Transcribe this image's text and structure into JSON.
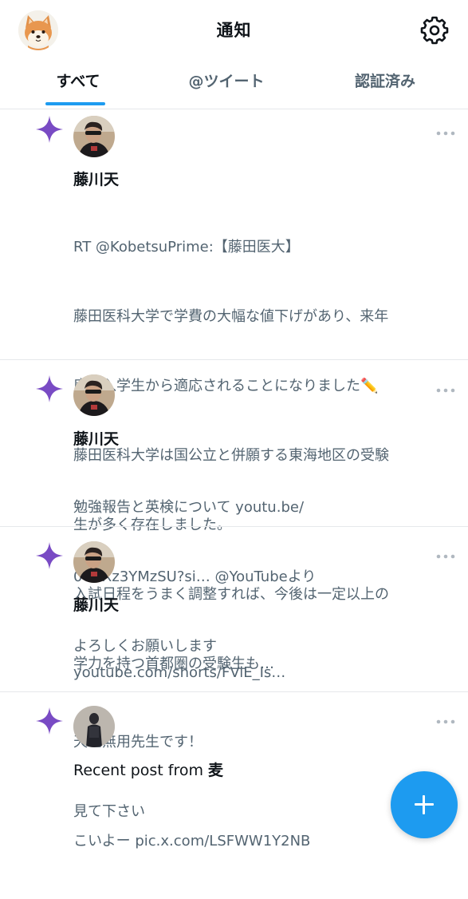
{
  "header": {
    "title": "通知",
    "avatar_icon": "shiba-dog-avatar",
    "settings_icon": "gear-icon"
  },
  "tabs": [
    {
      "label": "すべて",
      "active": true
    },
    {
      "label": "@ツイート",
      "active": false
    },
    {
      "label": "認証済み",
      "active": false
    }
  ],
  "colors": {
    "accent": "#1d9bf0",
    "sparkle": "#794bc4",
    "secondary_text": "#536471"
  },
  "notifications": [
    {
      "name": "藤川天",
      "lines": [
        "RT @KobetsuPrime:【藤田医大】",
        "藤田医科大学で学費の大幅な値下げがあり、来年",
        "度の入学生から適応されることになりました✏️",
        "藤田医科大学は国公立と併願する東海地区の受験",
        "生が多く存在しました。",
        "入試日程をうまく調整すれば、今後は一定以上の",
        "学力を持つ首都圏の受験生も…"
      ]
    },
    {
      "name": "藤川天",
      "lines": [
        "勉強報告と英検について youtu.be/",
        "0UnXz3YMzSU?si… @YouTubeより",
        "よろしくお願いします"
      ]
    },
    {
      "name": "藤川天",
      "lines": [
        "youtube.com/shorts/FViE_Is…",
        "天地無用先生です！",
        "見て下さい"
      ]
    },
    {
      "recent_prefix": "Recent post from ",
      "recent_name": "麦",
      "lines": [
        "こいよー pic.x.com/LSFWW1Y2NB"
      ]
    }
  ],
  "fab": {
    "icon": "plus-icon"
  }
}
